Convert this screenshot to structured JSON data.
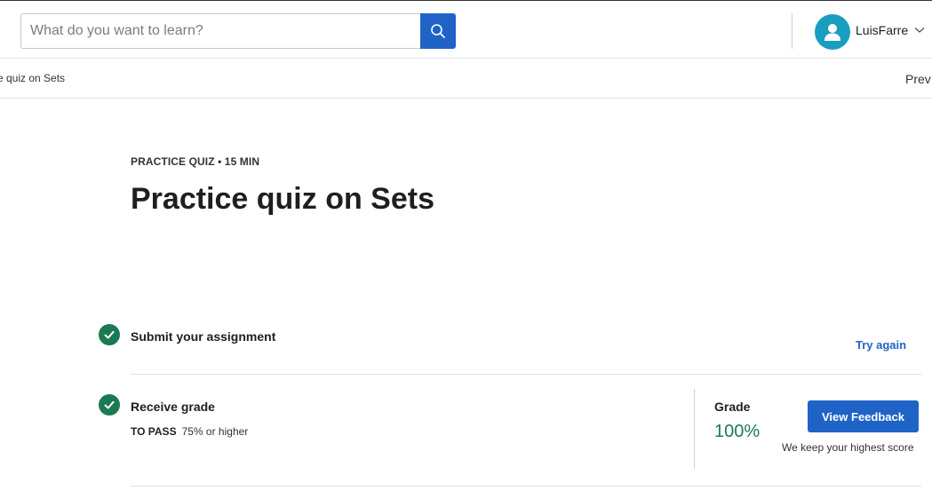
{
  "header": {
    "search": {
      "placeholder": "What do you want to learn?",
      "value": ""
    },
    "user": {
      "name": "LuisFarre"
    }
  },
  "subnav": {
    "breadcrumb": "e quiz on Sets",
    "prev_label": "Prev"
  },
  "quiz": {
    "kicker": "PRACTICE QUIZ • 15 MIN",
    "title": "Practice quiz on Sets"
  },
  "steps": {
    "submit": {
      "title": "Submit your assignment",
      "action_label": "Try again"
    },
    "grade": {
      "title": "Receive grade",
      "to_pass_label": "TO PASS",
      "to_pass_value": "75% or higher",
      "grade_label": "Grade",
      "grade_value": "100%",
      "feedback_button": "View Feedback",
      "note": "We keep your highest score"
    }
  },
  "colors": {
    "accent": "#1f63c6",
    "success": "#1a7a52",
    "avatar": "#1a9ec0"
  },
  "icons": [
    "search-icon",
    "user-icon",
    "chevron-down-icon",
    "check-icon"
  ]
}
